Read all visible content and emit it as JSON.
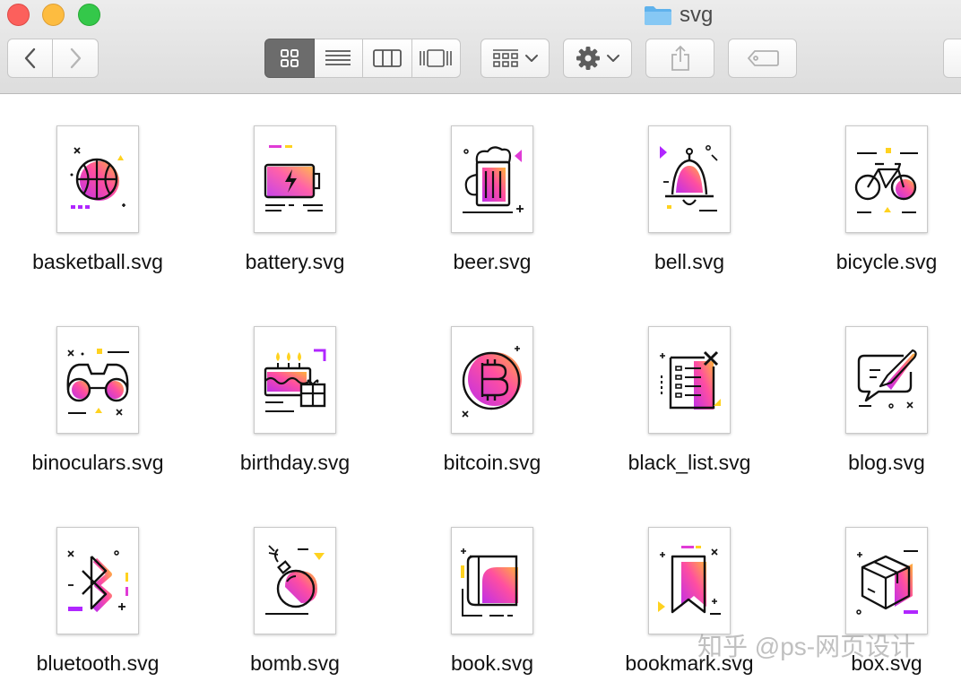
{
  "window": {
    "title": "svg",
    "title_icon": "folder-icon",
    "traffic_lights": [
      "#fc605c",
      "#fdbc40",
      "#34c84a"
    ]
  },
  "toolbar": {
    "back_icon": "chevron-left-icon",
    "forward_icon": "chevron-right-icon",
    "view_modes": [
      "icon-view-icon",
      "list-view-icon",
      "column-view-icon",
      "cover-flow-icon"
    ],
    "active_view": 0,
    "arrange_icon": "arrange-grid-icon",
    "action_icon": "gear-icon",
    "share_icon": "share-icon",
    "tags_icon": "tag-icon"
  },
  "colors": {
    "accent_pink": "#e03bd6",
    "accent_orange": "#ff8c3a",
    "accent_yellow": "#ffd21f",
    "accent_purple": "#b026ff"
  },
  "files": [
    {
      "name": "basketball.svg",
      "icon": "basketball-icon"
    },
    {
      "name": "battery.svg",
      "icon": "battery-icon"
    },
    {
      "name": "beer.svg",
      "icon": "beer-icon"
    },
    {
      "name": "bell.svg",
      "icon": "bell-icon"
    },
    {
      "name": "bicycle.svg",
      "icon": "bicycle-icon"
    },
    {
      "name": "binoculars.svg",
      "icon": "binoculars-icon"
    },
    {
      "name": "birthday.svg",
      "icon": "birthday-cake-icon"
    },
    {
      "name": "bitcoin.svg",
      "icon": "bitcoin-icon"
    },
    {
      "name": "black_list.svg",
      "icon": "black-list-icon"
    },
    {
      "name": "blog.svg",
      "icon": "blog-icon"
    },
    {
      "name": "bluetooth.svg",
      "icon": "bluetooth-icon"
    },
    {
      "name": "bomb.svg",
      "icon": "bomb-icon"
    },
    {
      "name": "book.svg",
      "icon": "book-icon"
    },
    {
      "name": "bookmark.svg",
      "icon": "bookmark-icon"
    },
    {
      "name": "box.svg",
      "icon": "box-icon"
    }
  ],
  "watermark": "知乎 @ps-网页设计"
}
